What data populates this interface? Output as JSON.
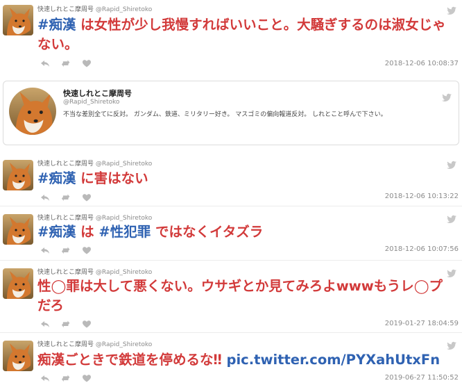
{
  "icons": {
    "avatar": "fox-avatar",
    "bird": "twitter-bird-icon",
    "reply": "reply-icon",
    "retweet": "retweet-icon",
    "like": "heart-icon"
  },
  "colors": {
    "tweet_text": "#d23a3a",
    "hashtag": "#2f62b2",
    "meta": "#8a8a8a"
  },
  "tweets": [
    {
      "display_name": "快速しれとこ摩周号",
      "handle": "@Rapid_Shiretoko",
      "text": [
        {
          "t": "#痴漢",
          "tag": true
        },
        {
          "t": " は女性が少し我慢すればいいこと。大騒ぎするのは淑女じゃない。",
          "tag": false
        }
      ],
      "timestamp": "2018-12-06 10:08:37"
    },
    {
      "display_name": "快速しれとこ摩周号",
      "handle": "@Rapid_Shiretoko",
      "text": [
        {
          "t": "#痴漢",
          "tag": true
        },
        {
          "t": " に害はない",
          "tag": false
        }
      ],
      "timestamp": "2018-12-06 10:13:22"
    },
    {
      "display_name": "快速しれとこ摩周号",
      "handle": "@Rapid_Shiretoko",
      "text": [
        {
          "t": "#痴漢",
          "tag": true
        },
        {
          "t": " は ",
          "tag": false
        },
        {
          "t": "#性犯罪",
          "tag": true
        },
        {
          "t": " ではなくイタズラ",
          "tag": false
        }
      ],
      "timestamp": "2018-12-06 10:07:56"
    },
    {
      "display_name": "快速しれとこ摩周号",
      "handle": "@Rapid_Shiretoko",
      "text": [
        {
          "t": "性◯罪は大して悪くない。ウサギとか見てみろよwwwもうレ◯プだろ",
          "tag": false
        }
      ],
      "timestamp": "2019-01-27 18:04:59"
    },
    {
      "display_name": "快速しれとこ摩周号",
      "handle": "@Rapid_Shiretoko",
      "text": [
        {
          "t": "痴漢ごときで鉄道を停めるな‼ ",
          "tag": false
        },
        {
          "t": "pic.twitter.com/PYXahUtxFn",
          "tag": true
        }
      ],
      "timestamp": "2019-06-27 11:50:52"
    }
  ],
  "profile_card": {
    "display_name": "快速しれとこ摩周号",
    "handle": "@Rapid_Shiretoko",
    "bio": "不当な差別全てに反対。 ガンダム、鉄道、ミリタリー好き。 マスゴミの偏向報道反対。 しれとこと呼んで下さい。"
  }
}
